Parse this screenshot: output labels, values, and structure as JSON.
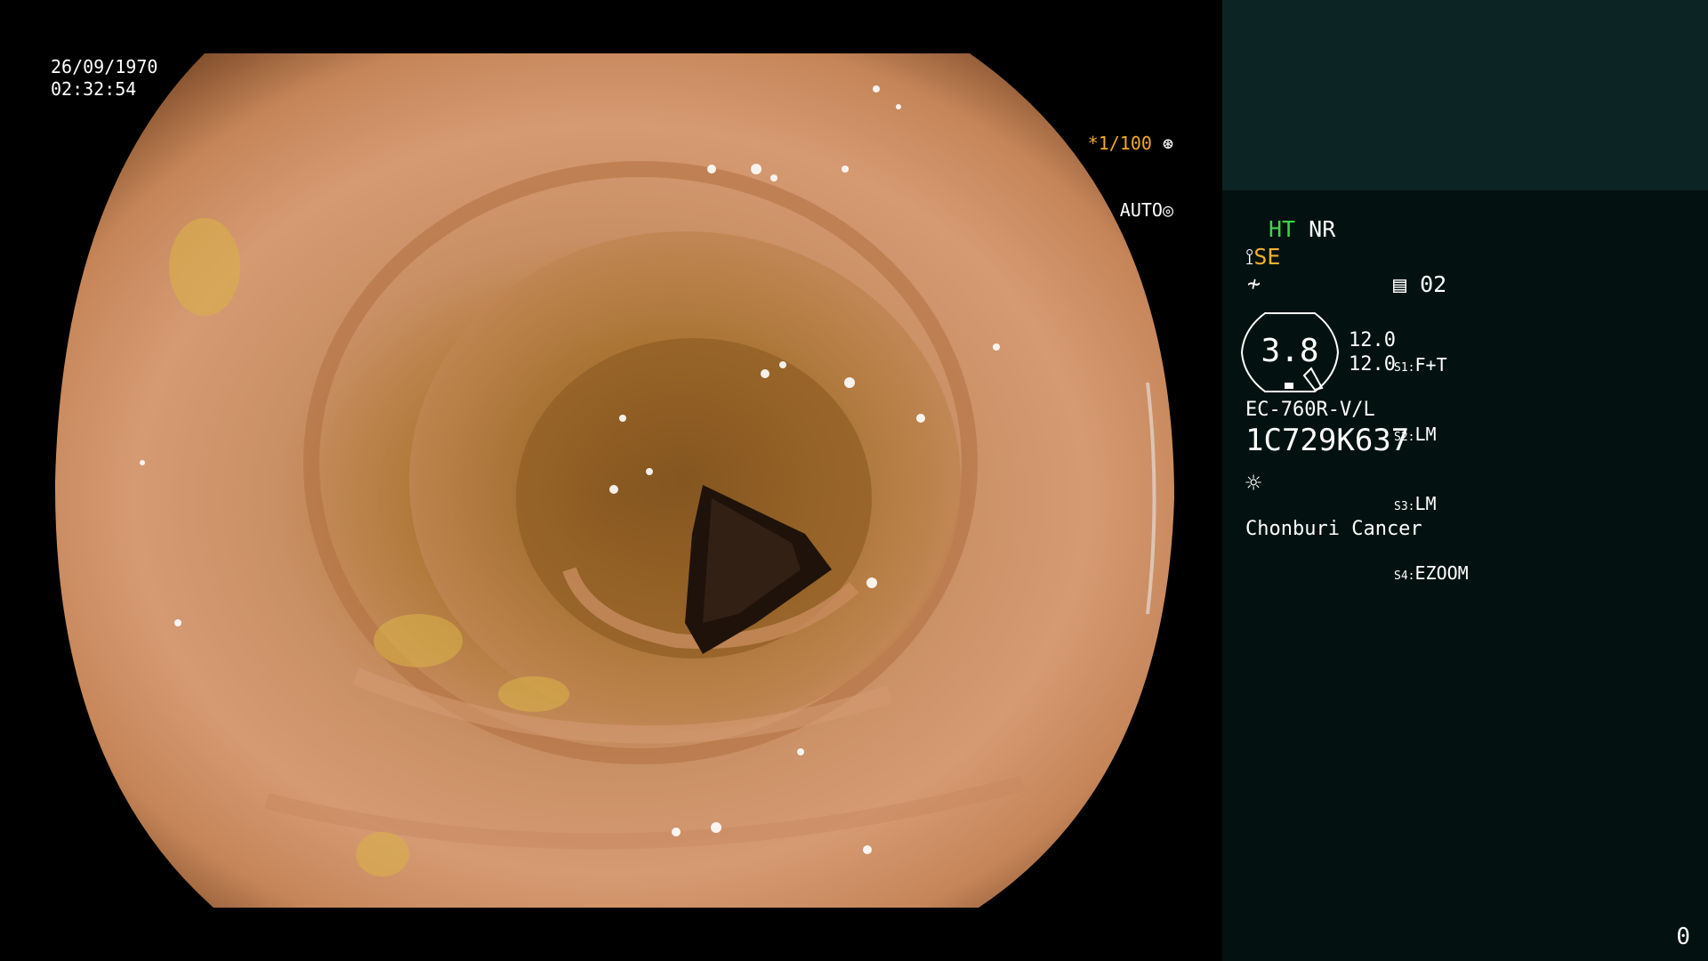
{
  "overlay": {
    "date": "26/09/1970",
    "time": "02:32:54",
    "shutter_value": "*1/100",
    "shutter_icon": "shutter-icon",
    "iris_mode": "AUTO",
    "iris_icon": "iris-icon"
  },
  "panel": {
    "ht": "HT",
    "nr": "NR",
    "se": "SE",
    "enhance_icon": "enhance-icon",
    "color_icon": "color-icon",
    "memory_icon": "memory-card-icon",
    "memory_slot": "02",
    "gauge_value": "3.8",
    "gauge_side_top": "12.0",
    "gauge_side_bottom": "12.0",
    "switches": [
      {
        "key": "S1:",
        "value": "F+T"
      },
      {
        "key": "S2:",
        "value": "LM"
      },
      {
        "key": "S3:",
        "value": "LM"
      },
      {
        "key": "S4:",
        "value": "EZOOM"
      }
    ],
    "scope_model": "EC-760R-V/L",
    "scope_serial": "1C729K637",
    "light_icon": "light-source-icon",
    "institution": "Chonburi Cancer",
    "frame_counter": "0"
  },
  "colors": {
    "panel_bg": "#031210",
    "panel_top_bg": "#0d2424",
    "ht_green": "#3fd64a",
    "se_orange": "#f2b02c",
    "shutter_orange": "#f2a92b"
  }
}
